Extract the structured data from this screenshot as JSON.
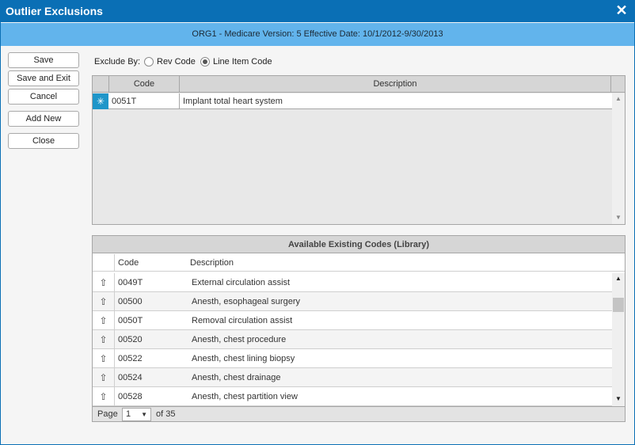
{
  "window": {
    "title": "Outlier Exclusions",
    "subheader": "ORG1 - Medicare Version: 5 Effective Date: 10/1/2012-9/30/2013"
  },
  "actions": {
    "save": "Save",
    "save_exit": "Save and Exit",
    "cancel": "Cancel",
    "add_new": "Add New",
    "close": "Close"
  },
  "exclude_by": {
    "label": "Exclude By:",
    "options": [
      "Rev Code",
      "Line Item Code"
    ],
    "selected": "Line Item Code"
  },
  "exclusions_grid": {
    "columns": [
      "Code",
      "Description"
    ],
    "rows": [
      {
        "code": "0051T",
        "description": "Implant total heart system"
      }
    ]
  },
  "library": {
    "caption": "Available Existing Codes (Library)",
    "columns": [
      "Code",
      "Description"
    ],
    "rows": [
      {
        "code": "0049T",
        "description": "External circulation assist"
      },
      {
        "code": "00500",
        "description": "Anesth, esophageal surgery"
      },
      {
        "code": "0050T",
        "description": "Removal circulation assist"
      },
      {
        "code": "00520",
        "description": "Anesth, chest procedure"
      },
      {
        "code": "00522",
        "description": "Anesth, chest lining biopsy"
      },
      {
        "code": "00524",
        "description": "Anesth, chest drainage"
      },
      {
        "code": "00528",
        "description": "Anesth, chest partition view"
      }
    ],
    "pager": {
      "page_label": "Page",
      "current": "1",
      "of_label": "of",
      "total": "35"
    }
  }
}
